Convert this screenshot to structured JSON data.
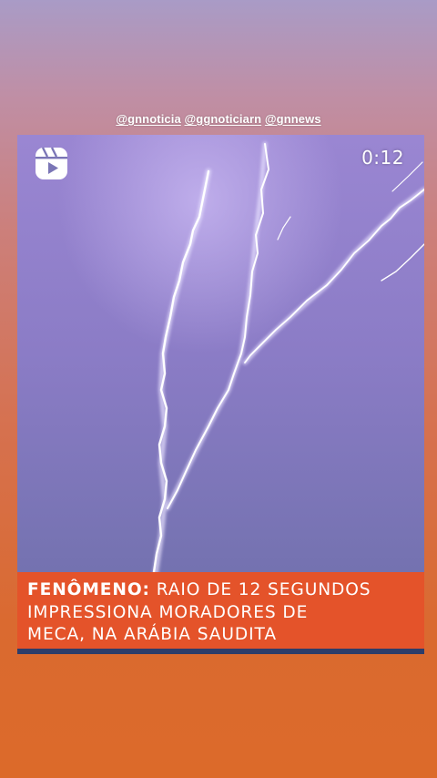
{
  "story": {
    "mentions": [
      "@gnnoticia",
      "@ggnoticiarn",
      "@gnnews"
    ]
  },
  "video": {
    "reels_icon": "instagram-reels-icon",
    "timer": "0:12",
    "headline": {
      "bold": "FENÔMENO:",
      "line1_rest": " RAIO DE 12 SEGUNDOS",
      "line2": "IMPRESSIONA MORADORES DE",
      "line3": "MECA, NA ARÁBIA SAUDITA"
    }
  },
  "colors": {
    "headline_bg": "#e4532a",
    "sky": "#7b76b6",
    "bottom_bar": "#2d3d6a"
  }
}
